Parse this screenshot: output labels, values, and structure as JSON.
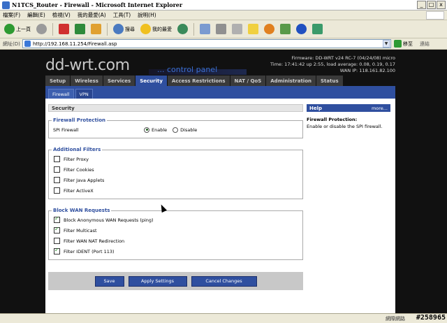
{
  "window": {
    "title": "N1TCS_Router - Firewall - Microsoft Internet Explorer",
    "btn_min": "_",
    "btn_max": "□",
    "btn_close": "x"
  },
  "menubar": {
    "items": [
      "檔案(F)",
      "編輯(E)",
      "檢視(V)",
      "我的最愛(A)",
      "工具(T)",
      "說明(H)"
    ]
  },
  "toolbar": {
    "back_label": "上一頁",
    "search_label": "搜尋",
    "favorites_label": "我的最愛"
  },
  "address": {
    "label": "網址(D)",
    "url": "http://192.168.11.254/Firewall.asp",
    "go_label": "移至",
    "links_label": "連結"
  },
  "header": {
    "logo": "dd-wrt.com",
    "logo_sub": "... control panel",
    "firmware": "Firmware: DD-WRT v24 RC-7 (04/24/08) micro",
    "time": "Time: 17:41:42 up 2:55, load average: 0.08, 0.19, 0.17",
    "wan_ip": "WAN IP: 118.161.82.100"
  },
  "tabs": [
    "Setup",
    "Wireless",
    "Services",
    "Security",
    "Access Restrictions",
    "NAT / QoS",
    "Administration",
    "Status"
  ],
  "subtabs": [
    "Firewall",
    "VPN"
  ],
  "security": {
    "heading": "Security",
    "firewall_protection": {
      "legend": "Firewall Protection",
      "spi_label": "SPI Firewall",
      "enable_label": "Enable",
      "disable_label": "Disable"
    },
    "additional_filters": {
      "legend": "Additional Filters",
      "items": [
        "Filter Proxy",
        "Filter Cookies",
        "Filter Java Applets",
        "Filter ActiveX"
      ]
    },
    "block_wan": {
      "legend": "Block WAN Requests",
      "items": [
        "Block Anonymous WAN Requests (ping)",
        "Filter Multicast",
        "Filter WAN NAT Redirection",
        "Filter IDENT (Port 113)"
      ]
    }
  },
  "buttons": {
    "save": "Save",
    "apply": "Apply Settings",
    "cancel": "Cancel Changes"
  },
  "help": {
    "heading": "Help",
    "more": "more...",
    "title": "Firewall Protection:",
    "text": "Enable or disable the SPI firewall."
  },
  "status": {
    "zone": "網際網路",
    "watermark": "#258965"
  }
}
